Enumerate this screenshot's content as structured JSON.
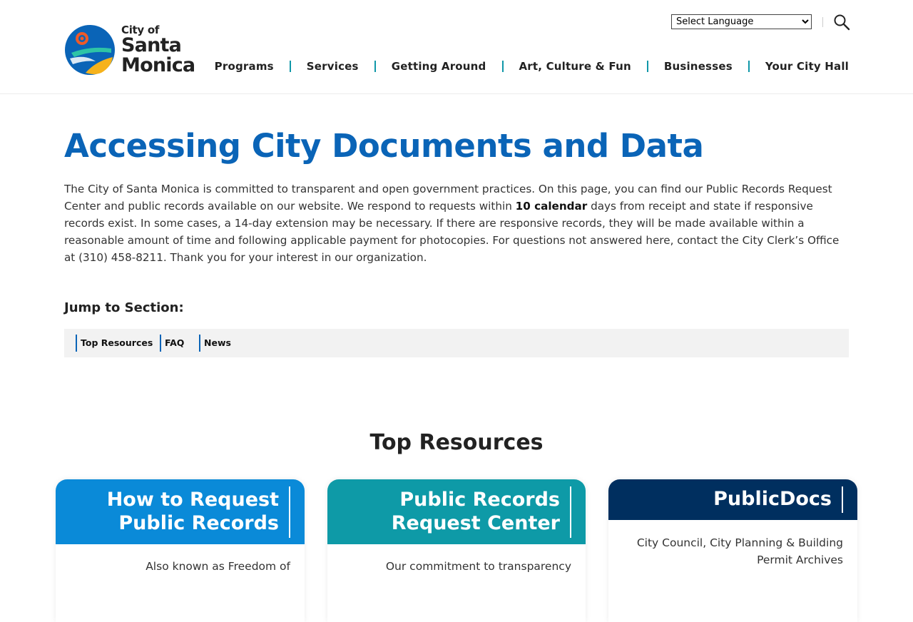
{
  "header": {
    "logo": {
      "line1": "City of",
      "line2": "Santa",
      "line3": "Monica"
    },
    "language_select": {
      "selected": "Select Language"
    },
    "nav": [
      {
        "label": "Programs"
      },
      {
        "label": "Services"
      },
      {
        "label": "Getting Around"
      },
      {
        "label": "Art, Culture & Fun"
      },
      {
        "label": "Businesses"
      },
      {
        "label": "Your City Hall"
      }
    ]
  },
  "main": {
    "title": "Accessing City Documents and Data",
    "intro": {
      "part1": "The City of Santa Monica is committed to transparent and open government practices. On this page, you can find our Public Records Request Center and public records available on our website. We respond to requests within ",
      "bold": "10 calendar",
      "part2": " days from receipt and state if responsive records exist. In some cases, a 14-day extension may be necessary. If there are responsive records, they will be made available within a reasonable amount of time and following applicable payment for photocopies. For questions not answered here, contact the City Clerk’s Office at (310) 458-8211. Thank you for your interest in our organization."
    },
    "jump": {
      "label": "Jump to Section:",
      "links": [
        {
          "label": "Top Resources"
        },
        {
          "label": "FAQ"
        },
        {
          "label": "News"
        }
      ]
    },
    "section_title": "Top Resources",
    "cards": [
      {
        "line1": "How to Request",
        "line2": "Public Records",
        "desc": "Also known as Freedom of",
        "color": "#0a8ad8"
      },
      {
        "line1": "Public Records",
        "line2": "Request Center",
        "desc": "Our commitment to transparency",
        "color": "#0e9aa7"
      },
      {
        "line1": "PublicDocs",
        "line2": "",
        "desc1": "City Council, City Planning & Building",
        "desc2": "Permit Archives",
        "color": "#002f5f"
      }
    ]
  },
  "colors": {
    "title_blue": "#0a64b7",
    "nav_separator": "#0f97a8"
  },
  "icons": {
    "search": "search-icon",
    "logo": "santa-monica-logo-icon"
  }
}
